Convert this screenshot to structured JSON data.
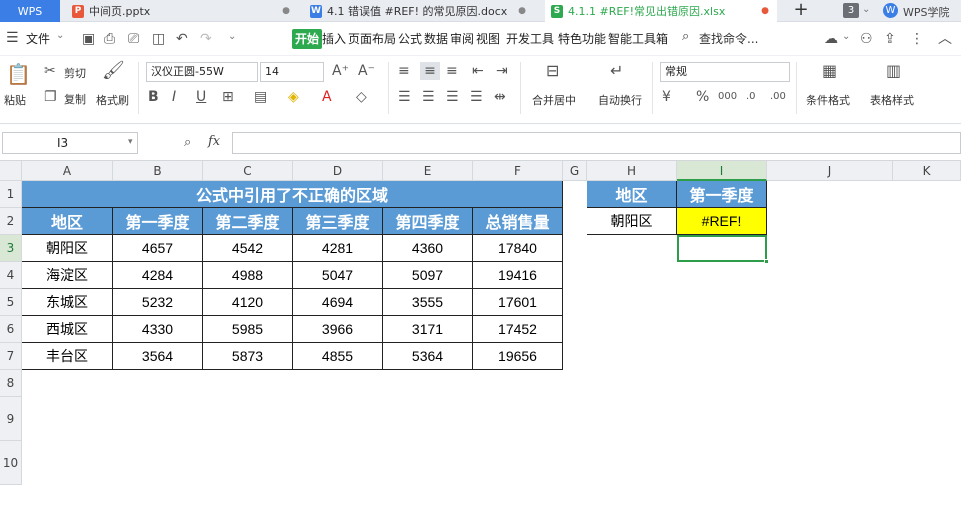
{
  "tabs": {
    "app": "WPS",
    "items": [
      {
        "label": "中间页.pptx",
        "badge": "P",
        "color": "#e8593c"
      },
      {
        "label": "4.1 错误值 #REF! 的常见原因.docx",
        "badge": "W",
        "color": "#3a7ee6"
      },
      {
        "label": "4.1.1 #REF!常见出错原因.xlsx",
        "badge": "S",
        "color": "#2da94f"
      }
    ],
    "new_tab": "+",
    "count": "3",
    "academy": "WPS学院"
  },
  "menu": {
    "file": "文件",
    "items": [
      "开始",
      "插入",
      "页面布局",
      "公式",
      "数据",
      "审阅",
      "视图",
      "开发工具",
      "特色功能",
      "智能工具箱"
    ],
    "search": "查找命令..."
  },
  "ribbon": {
    "paste": "粘贴",
    "cut": "剪切",
    "copy": "复制",
    "format_painter": "格式刷",
    "font_name": "汉仪正圆-55W",
    "font_size": "14",
    "merge_center": "合并居中",
    "wrap_text": "自动换行",
    "number_format": "常规",
    "conditional_format": "条件格式",
    "table_style": "表格样式"
  },
  "formula_bar": {
    "name_box": "I3",
    "fx": "fx",
    "formula": ""
  },
  "columns": [
    "A",
    "B",
    "C",
    "D",
    "E",
    "F",
    "G",
    "H",
    "I",
    "J",
    "K"
  ],
  "rows": [
    "1",
    "2",
    "3",
    "4",
    "5",
    "6",
    "7",
    "8",
    "9",
    "10"
  ],
  "sheet": {
    "title": "公式中引用了不正确的区域",
    "headers": [
      "地区",
      "第一季度",
      "第二季度",
      "第三季度",
      "第四季度",
      "总销售量"
    ],
    "data": [
      [
        "朝阳区",
        "4657",
        "4542",
        "4281",
        "4360",
        "17840"
      ],
      [
        "海淀区",
        "4284",
        "4988",
        "5047",
        "5097",
        "19416"
      ],
      [
        "东城区",
        "5232",
        "4120",
        "4694",
        "3555",
        "17601"
      ],
      [
        "西城区",
        "4330",
        "5985",
        "3966",
        "3171",
        "17452"
      ],
      [
        "丰台区",
        "3564",
        "5873",
        "4855",
        "5364",
        "19656"
      ]
    ],
    "lookup": {
      "headers": [
        "地区",
        "第一季度"
      ],
      "region": "朝阳区",
      "result": "#REF!"
    }
  },
  "colors": {
    "header_fill": "#5b9bd5",
    "error_fill": "#ffff00",
    "selection": "#2e9d4a",
    "accent": "#2da94f"
  }
}
